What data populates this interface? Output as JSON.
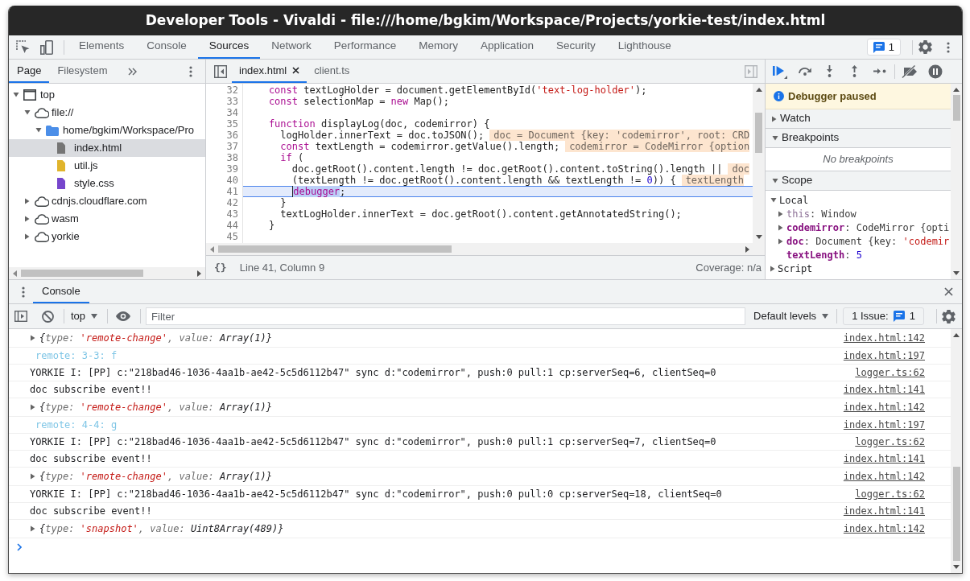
{
  "window": {
    "title": "Developer Tools - Vivaldi - file:///home/bgkim/Workspace/Projects/yorkie-test/index.html"
  },
  "toolbar": {
    "tabs": [
      {
        "label": "Elements",
        "selected": false
      },
      {
        "label": "Console",
        "selected": false
      },
      {
        "label": "Sources",
        "selected": true
      },
      {
        "label": "Network",
        "selected": false
      },
      {
        "label": "Performance",
        "selected": false
      },
      {
        "label": "Memory",
        "selected": false
      },
      {
        "label": "Application",
        "selected": false
      },
      {
        "label": "Security",
        "selected": false
      },
      {
        "label": "Lighthouse",
        "selected": false
      }
    ],
    "issues_count": "1"
  },
  "navigator": {
    "tabs": [
      {
        "label": "Page",
        "selected": true
      },
      {
        "label": "Filesystem",
        "selected": false
      }
    ],
    "tree": [
      {
        "kind": "frame",
        "label": "top",
        "expanded": true,
        "selected": false,
        "children": [
          {
            "kind": "domain",
            "label": "file://",
            "expanded": true,
            "selected": false,
            "children": [
              {
                "kind": "folder",
                "label": "home/bgkim/Workspace/Pro",
                "expanded": true,
                "selected": false,
                "children": [
                  {
                    "kind": "file",
                    "label": "index.html",
                    "color": "#757575",
                    "selected": true
                  },
                  {
                    "kind": "file",
                    "label": "util.js",
                    "color": "#e0b42c",
                    "selected": false
                  },
                  {
                    "kind": "file",
                    "label": "style.css",
                    "color": "#7646cc",
                    "selected": false
                  }
                ]
              }
            ]
          },
          {
            "kind": "domain",
            "label": "cdnjs.cloudflare.com",
            "expanded": false,
            "selected": false
          },
          {
            "kind": "domain",
            "label": "wasm",
            "expanded": false,
            "selected": false
          },
          {
            "kind": "domain",
            "label": "yorkie",
            "expanded": false,
            "selected": false
          }
        ]
      }
    ]
  },
  "editor": {
    "tabs": [
      {
        "label": "index.html",
        "selected": true,
        "closable": true
      },
      {
        "label": "client.ts",
        "selected": false,
        "closable": false
      }
    ],
    "lines": [
      {
        "number": "32",
        "paused": false,
        "tokens": [
          {
            "kind": "keyword",
            "text": "const"
          },
          {
            "kind": "plain",
            "text": " textLogHolder = document.getElementById("
          },
          {
            "kind": "string",
            "text": "'text-log-holder'"
          },
          {
            "kind": "plain",
            "text": ");"
          }
        ]
      },
      {
        "number": "33",
        "paused": false,
        "tokens": [
          {
            "kind": "keyword",
            "text": "const"
          },
          {
            "kind": "plain",
            "text": " selectionMap = "
          },
          {
            "kind": "keyword",
            "text": "new"
          },
          {
            "kind": "plain",
            "text": " Map();"
          }
        ]
      },
      {
        "number": "34",
        "paused": false
      },
      {
        "number": "35",
        "paused": false,
        "tokens": [
          {
            "kind": "keyword",
            "text": "function"
          },
          {
            "kind": "plain",
            "text": " displayLog(doc, codemirror) {"
          }
        ],
        "children": [
          {
            "number": "36",
            "paused": false,
            "tokens": [
              {
                "kind": "plain",
                "text": "logHolder.innerText = doc.toJSON();"
              }
            ],
            "inline_value": "doc = Document {key: 'codemirror', root: CRD"
          },
          {
            "number": "37",
            "paused": false,
            "tokens": [
              {
                "kind": "keyword",
                "text": "const"
              },
              {
                "kind": "plain",
                "text": " textLength = codemirror.getValue().length;"
              }
            ],
            "inline_value": "codemirror = CodeMirror {option"
          },
          {
            "number": "38",
            "paused": false,
            "tokens": [
              {
                "kind": "keyword",
                "text": "if"
              },
              {
                "kind": "plain",
                "text": " ("
              }
            ],
            "children": [
              {
                "number": "39",
                "paused": false,
                "tokens": [
                  {
                    "kind": "plain",
                    "text": "doc.getRoot().content.length != doc.getRoot().content.toString().length ||"
                  }
                ],
                "inline_value": "doc"
              },
              {
                "number": "40",
                "paused": false,
                "tokens": [
                  {
                    "kind": "plain",
                    "text": "(textLength != doc.getRoot().content.length && textLength != "
                  },
                  {
                    "kind": "number",
                    "text": "0"
                  },
                  {
                    "kind": "plain",
                    "text": ")) {"
                  }
                ],
                "inline_value": "textLength"
              },
              {
                "number": "41",
                "paused": true,
                "tokens": [
                  {
                    "kind": "highlight",
                    "text": "debugger"
                  },
                  {
                    "kind": "plain",
                    "text": ";"
                  }
                ]
              }
            ]
          },
          {
            "number": "42",
            "paused": false,
            "tokens": [
              {
                "kind": "plain",
                "text": "}"
              }
            ]
          },
          {
            "number": "43",
            "paused": false,
            "tokens": [
              {
                "kind": "plain",
                "text": "textLogHolder.innerText = doc.getRoot().content.getAnnotatedString();"
              }
            ]
          }
        ]
      },
      {
        "number": "44",
        "paused": false,
        "tokens": [
          {
            "kind": "plain",
            "text": "}"
          }
        ]
      },
      {
        "number": "45",
        "paused": false
      }
    ],
    "format_button": "{}",
    "cursor_position": "Line 41, Column 9",
    "coverage": "Coverage: n/a"
  },
  "debugger": {
    "status": "Debugger paused",
    "sections": [
      {
        "title": "Watch",
        "expanded": false
      },
      {
        "title": "Breakpoints",
        "expanded": true,
        "empty_text": "No breakpoints"
      },
      {
        "title": "Scope",
        "expanded": true,
        "groups": [
          {
            "name": "Local",
            "expanded": true,
            "variables": [
              {
                "kind": "object",
                "expanded": false,
                "tokens": [
                  {
                    "kind": "special",
                    "text": "this"
                  },
                  {
                    "kind": "plain",
                    "text": ": Window"
                  }
                ]
              },
              {
                "kind": "object",
                "expanded": false,
                "tokens": [
                  {
                    "kind": "property",
                    "text": "codemirror"
                  },
                  {
                    "kind": "plain",
                    "text": ": CodeMirror {opti"
                  }
                ]
              },
              {
                "kind": "object",
                "expanded": false,
                "tokens": [
                  {
                    "kind": "property",
                    "text": "doc"
                  },
                  {
                    "kind": "plain",
                    "text": ": Document {key: "
                  },
                  {
                    "kind": "string",
                    "text": "'codemir"
                  }
                ]
              },
              {
                "kind": "primitive",
                "tokens": [
                  {
                    "kind": "property",
                    "text": "textLength"
                  },
                  {
                    "kind": "plain",
                    "text": ": "
                  },
                  {
                    "kind": "number",
                    "text": "5"
                  }
                ]
              }
            ]
          },
          {
            "name": "Script",
            "expanded": false
          }
        ]
      }
    ]
  },
  "drawer": {
    "tabs": [
      {
        "label": "Console",
        "selected": true
      }
    ]
  },
  "console": {
    "context": "top",
    "filter_placeholder": "Filter",
    "levels": "Default levels",
    "issues_label": "1 Issue:",
    "issues_count": "1",
    "messages": [
      {
        "kind": "object",
        "expanded": false,
        "tokens": [
          {
            "kind": "plain",
            "text": "{"
          },
          {
            "kind": "key",
            "text": "type: "
          },
          {
            "kind": "string",
            "text": "'remote-change'"
          },
          {
            "kind": "key",
            "text": ", value: "
          },
          {
            "kind": "plain",
            "text": "Array(1)"
          },
          {
            "kind": "plain",
            "text": "}"
          }
        ],
        "source": "index.html:142"
      },
      {
        "kind": "styled",
        "color": "#80c6e6",
        "text": "remote: 3-3: f",
        "source": "index.html:197"
      },
      {
        "kind": "log",
        "text": "YORKIE I: [PP] c:\"218bad46-1036-4aa1b-ae42-5c5d6112b47\" sync d:\"codemirror\", push:0 pull:1 cp:serverSeq=6, clientSeq=0",
        "source": "logger.ts:62"
      },
      {
        "kind": "log",
        "text": "doc subscribe event!!",
        "source": "index.html:141"
      },
      {
        "kind": "object",
        "expanded": false,
        "tokens": [
          {
            "kind": "plain",
            "text": "{"
          },
          {
            "kind": "key",
            "text": "type: "
          },
          {
            "kind": "string",
            "text": "'remote-change'"
          },
          {
            "kind": "key",
            "text": ", value: "
          },
          {
            "kind": "plain",
            "text": "Array(1)"
          },
          {
            "kind": "plain",
            "text": "}"
          }
        ],
        "source": "index.html:142"
      },
      {
        "kind": "styled",
        "color": "#80c6e6",
        "text": "remote: 4-4: g",
        "source": "index.html:197"
      },
      {
        "kind": "log",
        "text": "YORKIE I: [PP] c:\"218bad46-1036-4aa1b-ae42-5c5d6112b47\" sync d:\"codemirror\", push:0 pull:1 cp:serverSeq=7, clientSeq=0",
        "source": "logger.ts:62"
      },
      {
        "kind": "log",
        "text": "doc subscribe event!!",
        "source": "index.html:141"
      },
      {
        "kind": "object",
        "expanded": false,
        "tokens": [
          {
            "kind": "plain",
            "text": "{"
          },
          {
            "kind": "key",
            "text": "type: "
          },
          {
            "kind": "string",
            "text": "'remote-change'"
          },
          {
            "kind": "key",
            "text": ", value: "
          },
          {
            "kind": "plain",
            "text": "Array(1)"
          },
          {
            "kind": "plain",
            "text": "}"
          }
        ],
        "source": "index.html:142"
      },
      {
        "kind": "log",
        "text": "YORKIE I: [PP] c:\"218bad46-1036-4aa1b-ae42-5c5d6112b47\" sync d:\"codemirror\", push:0 pull:0 cp:serverSeq=18, clientSeq=0",
        "source": "logger.ts:62"
      },
      {
        "kind": "log",
        "text": "doc subscribe event!!",
        "source": "index.html:141"
      },
      {
        "kind": "object",
        "expanded": false,
        "tokens": [
          {
            "kind": "plain",
            "text": "{"
          },
          {
            "kind": "key",
            "text": "type: "
          },
          {
            "kind": "string",
            "text": "'snapshot'"
          },
          {
            "kind": "key",
            "text": ", value: "
          },
          {
            "kind": "plain",
            "text": "Uint8Array(489)"
          },
          {
            "kind": "plain",
            "text": "}"
          }
        ],
        "source": "index.html:142"
      }
    ]
  }
}
